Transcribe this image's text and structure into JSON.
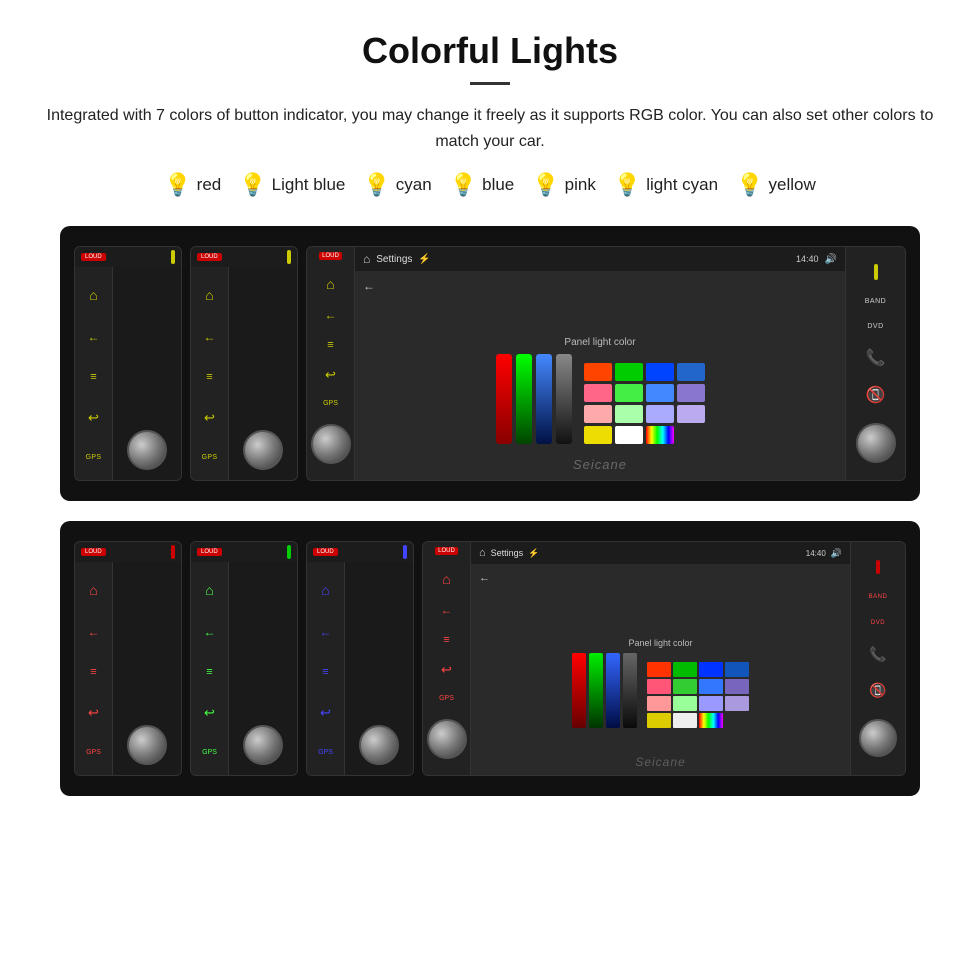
{
  "page": {
    "title": "Colorful Lights",
    "description": "Integrated with 7 colors of button indicator, you may change it freely as it supports RGB color. You can also set other colors to match your car.",
    "colors": [
      {
        "name": "red",
        "bulb": "🔴",
        "color": "#ff3366"
      },
      {
        "name": "Light blue",
        "bulb": "💙",
        "color": "#88ccff"
      },
      {
        "name": "cyan",
        "bulb": "🩵",
        "color": "#00ffff"
      },
      {
        "name": "blue",
        "bulb": "🔵",
        "color": "#3366ff"
      },
      {
        "name": "pink",
        "bulb": "🩷",
        "color": "#ff66cc"
      },
      {
        "name": "light cyan",
        "bulb": "🩵",
        "color": "#aaffee"
      },
      {
        "name": "yellow",
        "bulb": "💛",
        "color": "#ffee00"
      }
    ],
    "panel_light_label": "Panel light color",
    "watermark": "Seicane",
    "screen_title": "Settings",
    "time": "14:40"
  }
}
